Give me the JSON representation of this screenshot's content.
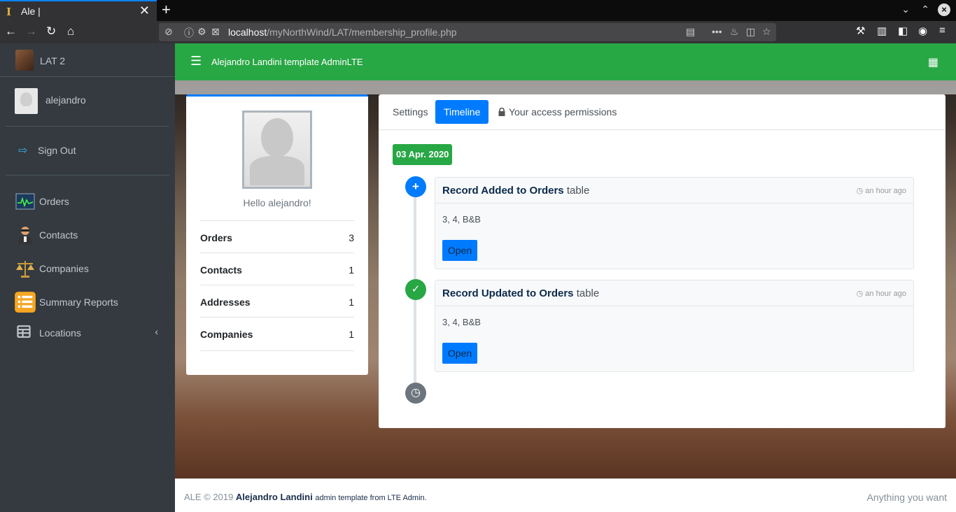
{
  "browser": {
    "tab_title": "Ale |",
    "url_host": "localhost",
    "url_path": "/myNorthWind/LAT/membership_profile.php"
  },
  "sidebar": {
    "brand": "LAT 2",
    "user_name": "alejandro",
    "sign_out": "Sign Out",
    "items": [
      {
        "label": "Orders",
        "icon": "orders-chart-icon"
      },
      {
        "label": "Contacts",
        "icon": "contacts-person-icon"
      },
      {
        "label": "Companies",
        "icon": "scales-icon"
      },
      {
        "label": "Summary Reports",
        "icon": "reports-list-icon"
      },
      {
        "label": "Locations",
        "icon": "table-grid-icon"
      }
    ]
  },
  "header": {
    "title": "Alejandro Landini template AdminLTE"
  },
  "profile": {
    "greeting": "Hello alejandro!",
    "stats": [
      {
        "label": "Orders",
        "value": "3"
      },
      {
        "label": "Contacts",
        "value": "1"
      },
      {
        "label": "Addresses",
        "value": "1"
      },
      {
        "label": "Companies",
        "value": "1"
      }
    ]
  },
  "tabs": {
    "settings": "Settings",
    "timeline": "Timeline",
    "permissions": "Your access permissions"
  },
  "timeline": {
    "date": "03 Apr. 2020",
    "entries": [
      {
        "action": "Record Added to Orders",
        "suffix": "table",
        "time": "an hour ago",
        "body": "3, 4, B&B",
        "button": "Open",
        "icon": "plus-icon",
        "color": "#007bff"
      },
      {
        "action": "Record Updated to Orders",
        "suffix": "table",
        "time": "an hour ago",
        "body": "3, 4, B&B",
        "button": "Open",
        "icon": "check-icon",
        "color": "#28a745"
      }
    ]
  },
  "footer": {
    "prefix": "ALE © 2019",
    "author": "Alejandro Landini",
    "suffix": "admin template from LTE Admin.",
    "right": "Anything you want"
  },
  "colors": {
    "sidebar_bg": "#343a40",
    "header_bg": "#28a745",
    "primary": "#007bff",
    "success": "#28a745"
  }
}
